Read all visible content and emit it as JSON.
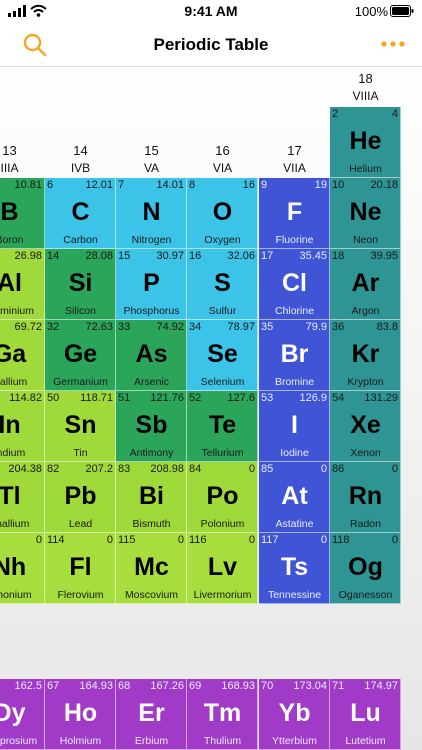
{
  "status_bar": {
    "time": "9:41 AM",
    "battery": "100%"
  },
  "nav": {
    "title": "Periodic Table",
    "accent": "#f5a623"
  },
  "colors": {
    "metalloid": "#2aa55a",
    "nonmetal": "#3cc3e8",
    "halogen": "#3f55d6",
    "noble": "#2e9494",
    "post_transition": "#9fd93a",
    "unknown": "#a7dd3c",
    "lanthanide": "#a23ac8"
  },
  "groups": [
    {
      "num": "13",
      "label": "IIIA"
    },
    {
      "num": "14",
      "label": "IVB"
    },
    {
      "num": "15",
      "label": "VA"
    },
    {
      "num": "16",
      "label": "VIA"
    },
    {
      "num": "17",
      "label": "VIIA"
    },
    {
      "num": "18",
      "label": "VIIIA"
    }
  ],
  "elements": [
    {
      "num": "2",
      "mass": "4",
      "sym": "He",
      "name": "Helium",
      "cat": "noble",
      "row": 0,
      "col": 5
    },
    {
      "num": "",
      "mass": "10.81",
      "sym": "B",
      "name": "Boron",
      "cat": "metalloid",
      "row": 1,
      "col": 0
    },
    {
      "num": "6",
      "mass": "12.01",
      "sym": "C",
      "name": "Carbon",
      "cat": "nonmetal",
      "row": 1,
      "col": 1
    },
    {
      "num": "7",
      "mass": "14.01",
      "sym": "N",
      "name": "Nitrogen",
      "cat": "nonmetal",
      "row": 1,
      "col": 2
    },
    {
      "num": "8",
      "mass": "16",
      "sym": "O",
      "name": "Oxygen",
      "cat": "nonmetal",
      "row": 1,
      "col": 3
    },
    {
      "num": "9",
      "mass": "19",
      "sym": "F",
      "name": "Fluorine",
      "cat": "halogen",
      "row": 1,
      "col": 4
    },
    {
      "num": "10",
      "mass": "20.18",
      "sym": "Ne",
      "name": "Neon",
      "cat": "noble",
      "row": 1,
      "col": 5
    },
    {
      "num": "",
      "mass": "26.98",
      "sym": "Al",
      "name": "Aluminium",
      "cat": "post_transition",
      "row": 2,
      "col": 0
    },
    {
      "num": "14",
      "mass": "28.08",
      "sym": "Si",
      "name": "Silicon",
      "cat": "metalloid",
      "row": 2,
      "col": 1
    },
    {
      "num": "15",
      "mass": "30.97",
      "sym": "P",
      "name": "Phosphorus",
      "cat": "nonmetal",
      "row": 2,
      "col": 2
    },
    {
      "num": "16",
      "mass": "32.06",
      "sym": "S",
      "name": "Sulfur",
      "cat": "nonmetal",
      "row": 2,
      "col": 3
    },
    {
      "num": "17",
      "mass": "35.45",
      "sym": "Cl",
      "name": "Chlorine",
      "cat": "halogen",
      "row": 2,
      "col": 4
    },
    {
      "num": "18",
      "mass": "39.95",
      "sym": "Ar",
      "name": "Argon",
      "cat": "noble",
      "row": 2,
      "col": 5
    },
    {
      "num": "",
      "mass": "69.72",
      "sym": "Ga",
      "name": "Gallium",
      "cat": "post_transition",
      "row": 3,
      "col": 0
    },
    {
      "num": "32",
      "mass": "72.63",
      "sym": "Ge",
      "name": "Germanium",
      "cat": "metalloid",
      "row": 3,
      "col": 1
    },
    {
      "num": "33",
      "mass": "74.92",
      "sym": "As",
      "name": "Arsenic",
      "cat": "metalloid",
      "row": 3,
      "col": 2
    },
    {
      "num": "34",
      "mass": "78.97",
      "sym": "Se",
      "name": "Selenium",
      "cat": "nonmetal",
      "row": 3,
      "col": 3
    },
    {
      "num": "35",
      "mass": "79.9",
      "sym": "Br",
      "name": "Bromine",
      "cat": "halogen",
      "row": 3,
      "col": 4
    },
    {
      "num": "36",
      "mass": "83.8",
      "sym": "Kr",
      "name": "Krypton",
      "cat": "noble",
      "row": 3,
      "col": 5
    },
    {
      "num": "",
      "mass": "114.82",
      "sym": "In",
      "name": "Indium",
      "cat": "post_transition",
      "row": 4,
      "col": 0
    },
    {
      "num": "50",
      "mass": "118.71",
      "sym": "Sn",
      "name": "Tin",
      "cat": "post_transition",
      "row": 4,
      "col": 1
    },
    {
      "num": "51",
      "mass": "121.76",
      "sym": "Sb",
      "name": "Antimony",
      "cat": "metalloid",
      "row": 4,
      "col": 2
    },
    {
      "num": "52",
      "mass": "127.6",
      "sym": "Te",
      "name": "Tellurium",
      "cat": "metalloid",
      "row": 4,
      "col": 3
    },
    {
      "num": "53",
      "mass": "126.9",
      "sym": "I",
      "name": "Iodine",
      "cat": "halogen",
      "row": 4,
      "col": 4
    },
    {
      "num": "54",
      "mass": "131.29",
      "sym": "Xe",
      "name": "Xenon",
      "cat": "noble",
      "row": 4,
      "col": 5
    },
    {
      "num": "",
      "mass": "204.38",
      "sym": "Tl",
      "name": "Thallium",
      "cat": "post_transition",
      "row": 5,
      "col": 0
    },
    {
      "num": "82",
      "mass": "207.2",
      "sym": "Pb",
      "name": "Lead",
      "cat": "post_transition",
      "row": 5,
      "col": 1
    },
    {
      "num": "83",
      "mass": "208.98",
      "sym": "Bi",
      "name": "Bismuth",
      "cat": "post_transition",
      "row": 5,
      "col": 2
    },
    {
      "num": "84",
      "mass": "0",
      "sym": "Po",
      "name": "Polonium",
      "cat": "post_transition",
      "row": 5,
      "col": 3
    },
    {
      "num": "85",
      "mass": "0",
      "sym": "At",
      "name": "Astatine",
      "cat": "halogen",
      "row": 5,
      "col": 4
    },
    {
      "num": "86",
      "mass": "0",
      "sym": "Rn",
      "name": "Radon",
      "cat": "noble",
      "row": 5,
      "col": 5
    },
    {
      "num": "",
      "mass": "0",
      "sym": "Nh",
      "name": "Nihonium",
      "cat": "unknown",
      "row": 6,
      "col": 0
    },
    {
      "num": "114",
      "mass": "0",
      "sym": "Fl",
      "name": "Flerovium",
      "cat": "unknown",
      "row": 6,
      "col": 1
    },
    {
      "num": "115",
      "mass": "0",
      "sym": "Mc",
      "name": "Moscovium",
      "cat": "unknown",
      "row": 6,
      "col": 2
    },
    {
      "num": "116",
      "mass": "0",
      "sym": "Lv",
      "name": "Livermorium",
      "cat": "unknown",
      "row": 6,
      "col": 3
    },
    {
      "num": "117",
      "mass": "0",
      "sym": "Ts",
      "name": "Tennessine",
      "cat": "halogen",
      "row": 6,
      "col": 4
    },
    {
      "num": "118",
      "mass": "0",
      "sym": "Og",
      "name": "Oganesson",
      "cat": "noble",
      "row": 6,
      "col": 5
    },
    {
      "num": "",
      "mass": "162.5",
      "sym": "Dy",
      "name": "Dysprosium",
      "cat": "lanthanide",
      "row": 7,
      "col": 0
    },
    {
      "num": "67",
      "mass": "164.93",
      "sym": "Ho",
      "name": "Holmium",
      "cat": "lanthanide",
      "row": 7,
      "col": 1
    },
    {
      "num": "68",
      "mass": "167.26",
      "sym": "Er",
      "name": "Erbium",
      "cat": "lanthanide",
      "row": 7,
      "col": 2
    },
    {
      "num": "69",
      "mass": "168.93",
      "sym": "Tm",
      "name": "Thulium",
      "cat": "lanthanide",
      "row": 7,
      "col": 3
    },
    {
      "num": "70",
      "mass": "173.04",
      "sym": "Yb",
      "name": "Ytterbium",
      "cat": "lanthanide",
      "row": 7,
      "col": 4
    },
    {
      "num": "71",
      "mass": "174.97",
      "sym": "Lu",
      "name": "Lutetium",
      "cat": "lanthanide",
      "row": 7,
      "col": 5
    }
  ]
}
